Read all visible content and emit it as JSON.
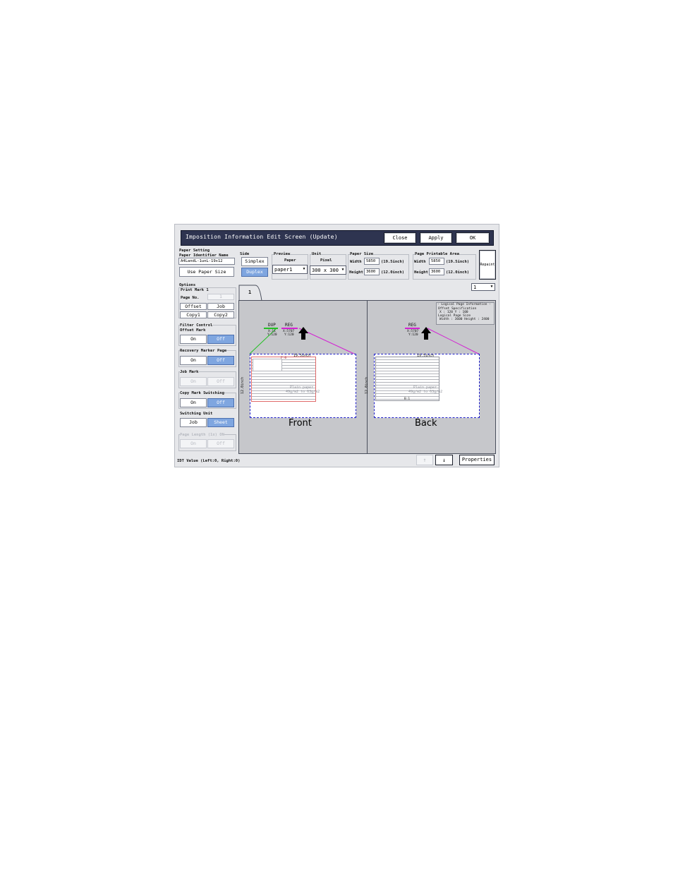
{
  "window": {
    "title": "Imposition Information Edit Screen (Update)",
    "buttons": {
      "close": "Close",
      "apply": "Apply",
      "ok": "OK"
    }
  },
  "paper_setting": {
    "heading": "Paper Setting",
    "identifier_label": "Paper Identifier Name",
    "identifier_value": "A4LandL-1unL-19x12",
    "use_paper_size": "Use Paper Size"
  },
  "side": {
    "label": "Side",
    "simplex": "Simplex",
    "duplex": "Duplex",
    "selected": "Duplex"
  },
  "preview": {
    "label": "Preview",
    "sub": "Paper",
    "value": "paper1"
  },
  "unit": {
    "label": "Unit",
    "sub": "Pixel",
    "value": "300 x 300"
  },
  "paper_size": {
    "label": "Paper Size",
    "width_label": "Width",
    "width": "5850",
    "width_inch": "(19.5inch)",
    "height_label": "Height",
    "height": "3600",
    "height_inch": "(12.0inch)"
  },
  "printable": {
    "label": "Page Printable Area",
    "width_label": "Width",
    "width": "5850",
    "width_inch": "(19.5inch)",
    "height_label": "Height",
    "height": "3600",
    "height_inch": "(12.0inch)",
    "repaint": "Repaint"
  },
  "options": {
    "heading": "Options",
    "print_mark": "Print Mark 1",
    "page_no": "Page No.",
    "page_no_value": "1",
    "offset": "Offset",
    "job": "Job",
    "copy1": "Copy1",
    "copy2": "Copy2",
    "filter_control": "Filter Control",
    "offset_mark": "Offset Mark",
    "recovery_marker": "Recovery Marker Page",
    "job_mark": "Job Mark",
    "copy_mark_switching": "Copy Mark Switching",
    "switching_unit": "Switching Unit",
    "switching_job": "Job",
    "switching_sheet": "Sheet",
    "page_length": "Page Length (1x) ON",
    "on": "On",
    "off": "Off"
  },
  "tab": {
    "label": "1"
  },
  "page_select": "1",
  "preview_area": {
    "front": {
      "caption": "Front",
      "dup": "DUP",
      "dup_x": "X:11",
      "dup_y": "Y:120",
      "reg": "REG",
      "reg_x": "X:5707",
      "reg_y": "Y:120",
      "width_text": "19.5inch",
      "height_text": "12.0inch",
      "page_label": "F:0",
      "paper_text1": "Plain paper",
      "paper_text2": "49g/m2 to 63g/m2"
    },
    "back": {
      "caption": "Back",
      "reg": "REG",
      "reg_x": "X:5707",
      "reg_y": "Y:120",
      "width_text": "19.5inch",
      "height_text": "12.0inch",
      "page_label": "B:1",
      "paper_text1": "Plain paper",
      "paper_text2": "49g/m2 to 63g/m2"
    },
    "logical_info": {
      "title": "- Logical Page Information -",
      "offset_spec": "Offset Specification",
      "offset_vals": "X : 120   Y : 100",
      "size_label": "Logical Page Size",
      "size_vals": "Width : 3600   Height : 2400"
    }
  },
  "status": "IDT Value (Left:0, Right:0)",
  "nav": {
    "up": "↑",
    "down": "↓",
    "properties": "Properties"
  },
  "colors": {
    "title_bar": "#2e3450",
    "selected": "#7fa6e0",
    "preview_bg": "#c6c7cb",
    "dup_mark": "#22c022",
    "reg_mark": "#d322d3"
  }
}
